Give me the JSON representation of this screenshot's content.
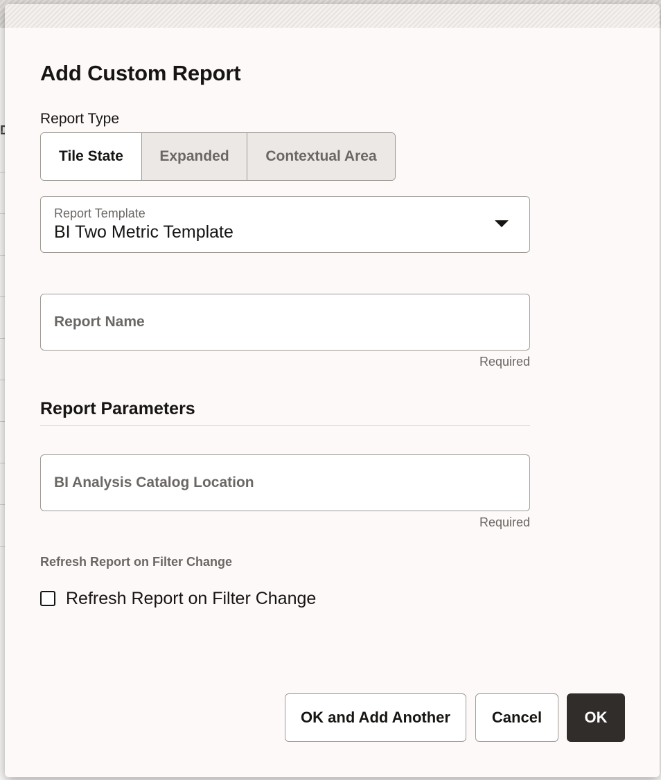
{
  "dialog": {
    "title": "Add Custom Report",
    "report_type": {
      "label": "Report Type",
      "options": [
        "Tile State",
        "Expanded",
        "Contextual Area"
      ],
      "selected": "Tile State"
    },
    "report_template": {
      "label": "Report Template",
      "value": "BI Two Metric Template"
    },
    "report_name": {
      "placeholder": "Report Name",
      "value": "",
      "helper": "Required"
    },
    "parameters": {
      "title": "Report Parameters",
      "catalog_location": {
        "placeholder": "BI Analysis Catalog Location",
        "value": "",
        "helper": "Required"
      },
      "refresh": {
        "group_label": "Refresh Report on Filter Change",
        "checkbox_label": "Refresh Report on Filter Change",
        "checked": false
      }
    },
    "buttons": {
      "ok_and_add_another": "OK and Add Another",
      "cancel": "Cancel",
      "ok": "OK"
    }
  },
  "background": {
    "partial_glyph": "D"
  }
}
